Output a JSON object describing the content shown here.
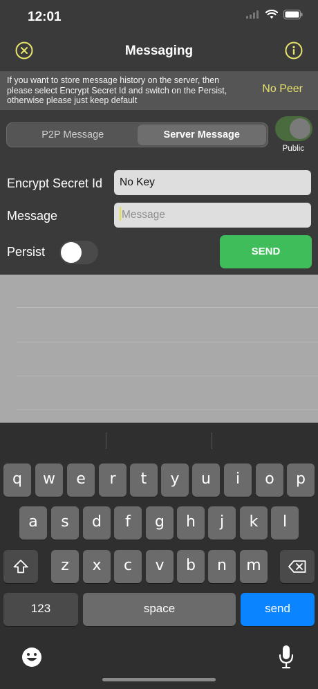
{
  "status_bar": {
    "time": "12:01"
  },
  "nav": {
    "title": "Messaging",
    "close_icon": "close-circle-icon",
    "info_icon": "info-circle-icon"
  },
  "banner": {
    "text": "If you want to store message history on the server, then please select Encrypt Secret Id and switch on the Persist, otherwise please just keep default",
    "peer_status": "No Peer",
    "accent_color": "#e8e36a"
  },
  "mode": {
    "tabs": [
      "P2P Message",
      "Server Message"
    ],
    "selected": "Server Message",
    "public_label": "Public",
    "public_on": true
  },
  "form": {
    "secret_label": "Encrypt Secret Id",
    "secret_value": "No Key",
    "message_label": "Message",
    "message_placeholder": "Message",
    "persist_label": "Persist",
    "persist_on": false,
    "send_label": "SEND",
    "send_color": "#3fbd5a"
  },
  "keyboard": {
    "row1": [
      "q",
      "w",
      "e",
      "r",
      "t",
      "y",
      "u",
      "i",
      "o",
      "p"
    ],
    "row2": [
      "a",
      "s",
      "d",
      "f",
      "g",
      "h",
      "j",
      "k",
      "l"
    ],
    "row3": [
      "z",
      "x",
      "c",
      "v",
      "b",
      "n",
      "m"
    ],
    "numbers_label": "123",
    "space_label": "space",
    "send_label": "send",
    "send_color": "#0a84ff"
  }
}
